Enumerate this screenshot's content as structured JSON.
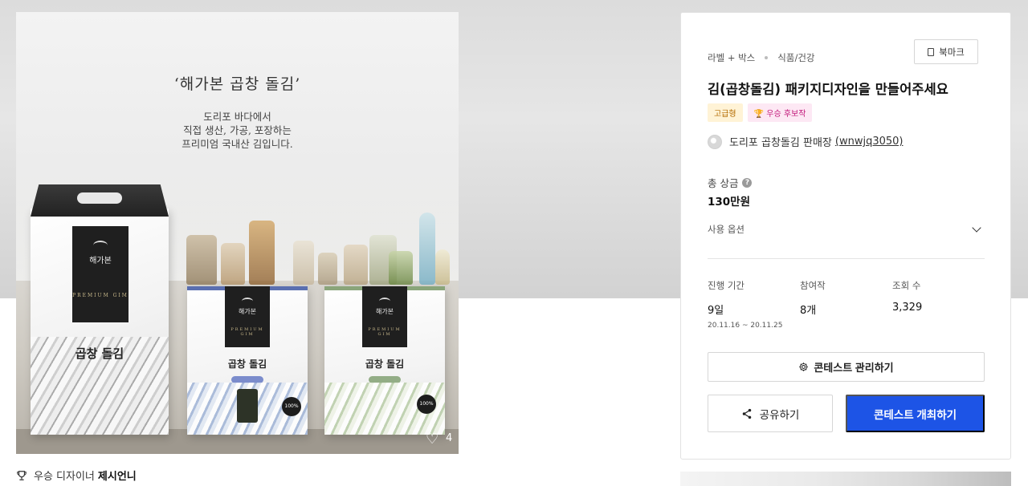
{
  "hero": {
    "title": "‘해가본 곱창 돌김’",
    "desc": [
      "도리포 바다에서",
      "직접 생산, 가공, 포장하는",
      "프리미엄 국내산 김입니다."
    ],
    "brand": "해가본",
    "premium": "PREMIUM GIM",
    "product_name": "곱창 돌김",
    "badge": "100%",
    "like_count": "4"
  },
  "winner": {
    "label": "우승 디자이너",
    "name": "제시언니"
  },
  "panel": {
    "category_primary": "라벨 + 박스",
    "category_secondary": "식품/건강",
    "bookmark_label": "북마크",
    "title": "김(곱창돌김) 패키지디자인을 만들어주세요",
    "tags": [
      "고급형",
      "우승 후보작"
    ],
    "owner_name": "도리포 곱창돌김 판매장",
    "owner_handle": "(wnwjq3050)",
    "prize_label": "총 상금",
    "prize_value": "130만원",
    "options_label": "사용 옵션",
    "stats": [
      {
        "label": "진행 기간",
        "value": "9일",
        "sub": "20.11.16 ~ 20.11.25"
      },
      {
        "label": "참여작",
        "value": "8개",
        "sub": ""
      },
      {
        "label": "조회 수",
        "value": "3,329",
        "sub": ""
      }
    ],
    "manage_label": "콘테스트 관리하기",
    "share_label": "공유하기",
    "host_label": "콘테스트 개최하기"
  },
  "colors": {
    "primary_button": "#1d54e6",
    "tag_gold_text": "#b36b00",
    "tag_pink_text": "#c2187a"
  }
}
